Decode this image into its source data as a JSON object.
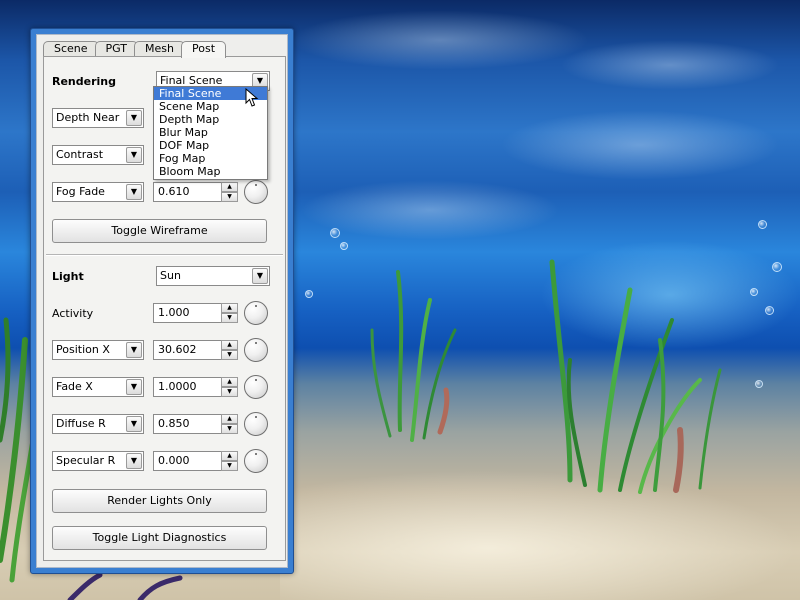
{
  "tabs": [
    "Scene",
    "PGT",
    "Mesh",
    "Post"
  ],
  "active_tab": "Post",
  "rendering": {
    "label": "Rendering",
    "selected": "Final Scene",
    "options": [
      "Final Scene",
      "Scene Map",
      "Depth Map",
      "Blur Map",
      "DOF Map",
      "Fog Map",
      "Bloom Map"
    ],
    "highlighted": "Final Scene"
  },
  "depth_near": {
    "combo": "Depth Near"
  },
  "contrast": {
    "combo": "Contrast"
  },
  "fog_fade": {
    "combo": "Fog Fade",
    "value": "0.610"
  },
  "toggle_wireframe": "Toggle Wireframe",
  "light": {
    "label": "Light",
    "selected": "Sun",
    "activity_label": "Activity",
    "activity_value": "1.000",
    "position": {
      "combo": "Position X",
      "value": "30.602"
    },
    "fade": {
      "combo": "Fade X",
      "value": "1.0000"
    },
    "diffuse": {
      "combo": "Diffuse R",
      "value": "0.850"
    },
    "specular": {
      "combo": "Specular R",
      "value": "0.000"
    }
  },
  "render_lights_only": "Render Lights Only",
  "toggle_light_diagnostics": "Toggle Light Diagnostics",
  "colors": {
    "window_frame": "#3a7fd1",
    "selection": "#3f7ad6",
    "panel": "#f3f3f1"
  }
}
